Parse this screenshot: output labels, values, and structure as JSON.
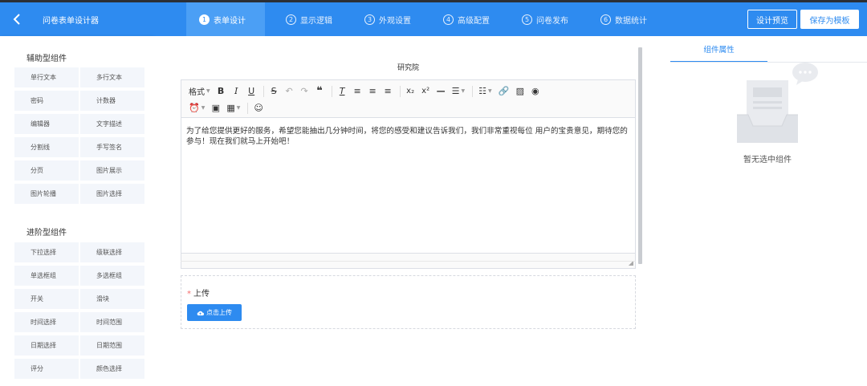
{
  "header": {
    "title": "问卷表单设计器",
    "steps": [
      {
        "num": "1",
        "label": "表单设计"
      },
      {
        "num": "2",
        "label": "显示逻辑"
      },
      {
        "num": "3",
        "label": "外观设置"
      },
      {
        "num": "4",
        "label": "高级配置"
      },
      {
        "num": "5",
        "label": "问卷发布"
      },
      {
        "num": "6",
        "label": "数据统计"
      }
    ],
    "preview_label": "设计预览",
    "save_template_label": "保存为模板"
  },
  "left_panel": {
    "groups": [
      {
        "title": "辅助型组件",
        "items": [
          "单行文本",
          "多行文本",
          "密码",
          "计数器",
          "编辑器",
          "文字描述",
          "分割线",
          "手写签名",
          "分页",
          "图片展示",
          "图片轮播",
          "图片选择"
        ]
      },
      {
        "title": "进阶型组件",
        "items": [
          "下拉选择",
          "级联选择",
          "单选框组",
          "多选框组",
          "开关",
          "滑块",
          "时间选择",
          "时间范围",
          "日期选择",
          "日期范围",
          "评分",
          "颜色选择"
        ]
      }
    ]
  },
  "canvas": {
    "editor_label": "研究院",
    "toolbar_format": "格式",
    "editor_content": "为了给您提供更好的服务，希望您能抽出几分钟时间，将您的感受和建议告诉我们，我们非常重视每位 用户的宝贵意见，期待您的参与！现在我们就马上开始吧！",
    "upload_label": "上传",
    "upload_button": "点击上传"
  },
  "right_panel": {
    "tab_label": "组件属性",
    "empty_text": "暂无选中组件"
  },
  "colors": {
    "primary": "#2e8bf0",
    "header_active": "#4b9ff5",
    "top_strip": "#2b2f36",
    "required": "#f56c6c"
  }
}
